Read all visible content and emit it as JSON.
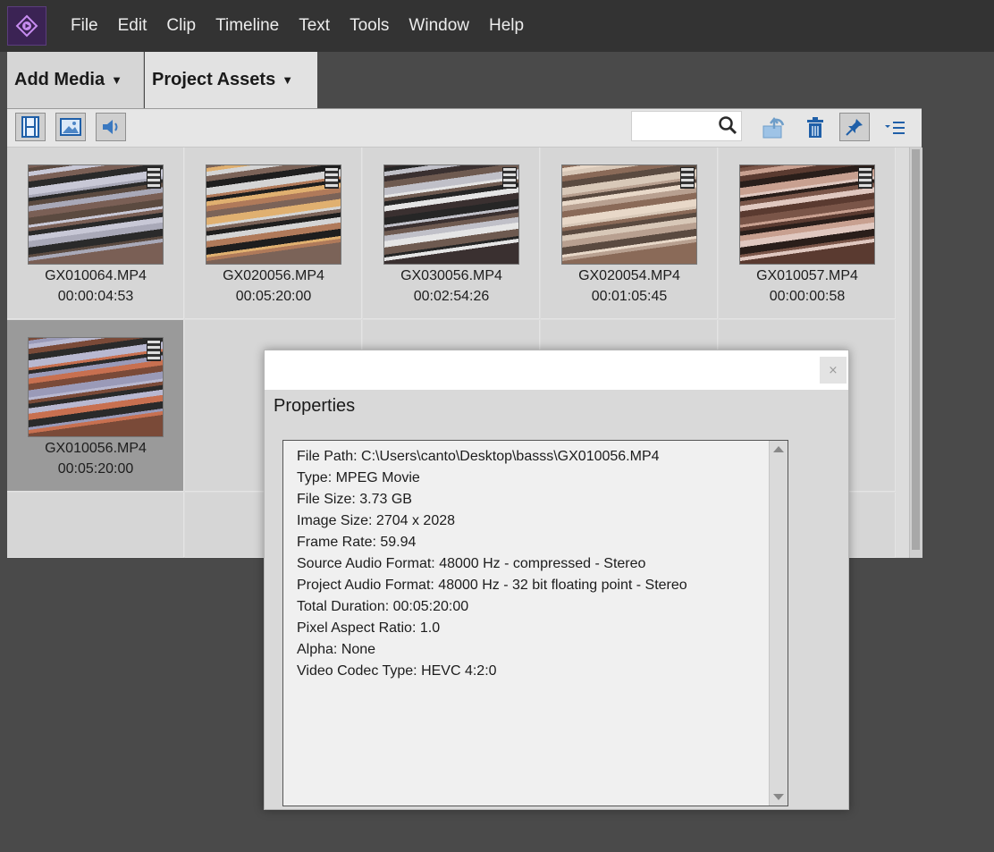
{
  "menu": [
    "File",
    "Edit",
    "Clip",
    "Timeline",
    "Text",
    "Tools",
    "Window",
    "Help"
  ],
  "tabs": {
    "add_media": "Add Media",
    "project_assets": "Project Assets"
  },
  "toolbar": {
    "icons": [
      "film-icon",
      "image-icon",
      "speaker-icon",
      "search-icon",
      "export-icon",
      "trash-icon",
      "pin-icon",
      "list-menu-icon"
    ],
    "search_value": ""
  },
  "assets": [
    {
      "name": "GX010064.MP4",
      "duration": "00:00:04:53",
      "selected": false,
      "palette": [
        "#7a5f55",
        "#c8c8d6",
        "#2a2a2a",
        "#a9a9b8",
        "#5b4a40"
      ]
    },
    {
      "name": "GX020056.MP4",
      "duration": "00:05:20:00",
      "selected": false,
      "palette": [
        "#7b6358",
        "#d4d4d4",
        "#1e1e1e",
        "#b07a5a",
        "#e0b070"
      ]
    },
    {
      "name": "GX030056.MP4",
      "duration": "00:02:54:26",
      "selected": false,
      "palette": [
        "#3a3030",
        "#c0c0c8",
        "#6e5a50",
        "#e5e5e5",
        "#262626"
      ]
    },
    {
      "name": "GX020054.MP4",
      "duration": "00:01:05:45",
      "selected": false,
      "palette": [
        "#8a6a58",
        "#d8c8b8",
        "#5a4a40",
        "#b8a090",
        "#e8d8c8"
      ]
    },
    {
      "name": "GX010057.MP4",
      "duration": "00:00:00:58",
      "selected": false,
      "palette": [
        "#5a3a30",
        "#c8a090",
        "#2a1e1a",
        "#e0c8c0",
        "#7a5548"
      ]
    },
    {
      "name": "GX010056.MP4",
      "duration": "00:05:20:00",
      "selected": true,
      "palette": [
        "#7a4a38",
        "#b8b8d0",
        "#2a2a2a",
        "#c87050",
        "#9a9ab8"
      ]
    }
  ],
  "properties": {
    "title": "Properties",
    "close_label": "×",
    "lines": [
      "File Path: C:\\Users\\canto\\Desktop\\basss\\GX010056.MP4",
      "Type: MPEG Movie",
      "File Size: 3.73 GB",
      "Image Size: 2704 x 2028",
      "Frame Rate: 59.94",
      "Source Audio Format: 48000 Hz - compressed - Stereo",
      "Project Audio Format: 48000 Hz - 32 bit floating point - Stereo",
      "Total Duration: 00:05:20:00",
      "Pixel Aspect Ratio: 1.0",
      "Alpha: None",
      "Video Codec Type: HEVC 4:2:0"
    ]
  }
}
